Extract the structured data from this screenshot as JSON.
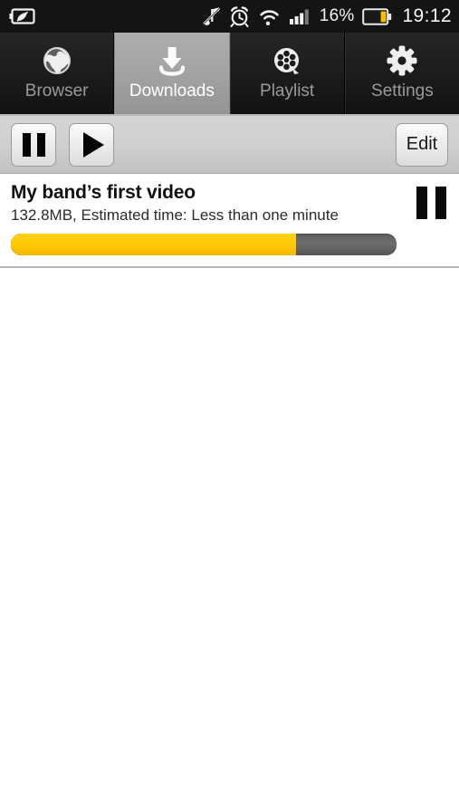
{
  "status_bar": {
    "power_saving_icon": "battery-leaf-icon",
    "mute_icon": "mute-note-icon",
    "alarm_icon": "alarm-clock-icon",
    "wifi_icon": "wifi-icon",
    "signal_icon": "cellular-signal-icon",
    "battery_percent": "16%",
    "battery_icon": "battery-icon",
    "battery_level": 16,
    "time": "19:12",
    "background_color": "#141414",
    "battery_fill_color": "#ffbf00"
  },
  "tabs": [
    {
      "label": "Browser",
      "icon": "globe-icon",
      "selected": false
    },
    {
      "label": "Downloads",
      "icon": "download-arrow-icon",
      "selected": true
    },
    {
      "label": "Playlist",
      "icon": "film-reel-icon",
      "selected": false
    },
    {
      "label": "Settings",
      "icon": "gear-icon",
      "selected": false
    }
  ],
  "toolbar": {
    "pause_all_label": "pause-all",
    "pause_icon": "pause-icon",
    "resume_all_label": "resume-all",
    "play_icon": "play-icon",
    "edit_label": "Edit"
  },
  "downloads": [
    {
      "title": "My band’s first video",
      "details": "132.8MB, Estimated time: Less than one minute",
      "progress_percent": 74,
      "action_icon": "pause-icon",
      "fill_color": "#ffcb05",
      "track_color": "#6e6e6e"
    }
  ]
}
